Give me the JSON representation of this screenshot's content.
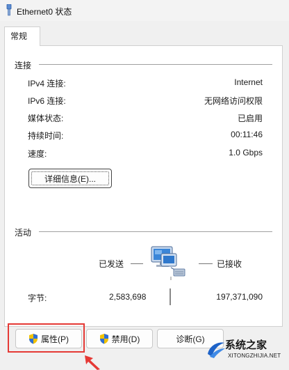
{
  "window": {
    "title": "Ethernet0 状态",
    "icon": "ethernet-plug-icon"
  },
  "tabs": [
    {
      "label": "常规"
    }
  ],
  "connection": {
    "heading": "连接",
    "rows": [
      {
        "label": "IPv4 连接:",
        "value": "Internet"
      },
      {
        "label": "IPv6 连接:",
        "value": "无网络访问权限"
      },
      {
        "label": "媒体状态:",
        "value": "已启用"
      },
      {
        "label": "持续时间:",
        "value": "00:11:46"
      },
      {
        "label": "速度:",
        "value": "1.0 Gbps"
      }
    ],
    "details_button": "详细信息(E)..."
  },
  "activity": {
    "heading": "活动",
    "sent_label": "已发送",
    "received_label": "已接收",
    "bytes_label": "字节:",
    "bytes_sent": "2,583,698",
    "bytes_received": "197,371,090",
    "icon": "network-computer-icon"
  },
  "buttons": {
    "properties": "属性(P)",
    "disable": "禁用(D)",
    "diagnose": "诊断(G)"
  },
  "watermark": {
    "line1": "系统之家",
    "line2": "XITONGZHIJIA.NET"
  },
  "colors": {
    "highlight": "#e53935",
    "shield_blue": "#2f6fd6",
    "shield_yellow": "#f2c200"
  }
}
